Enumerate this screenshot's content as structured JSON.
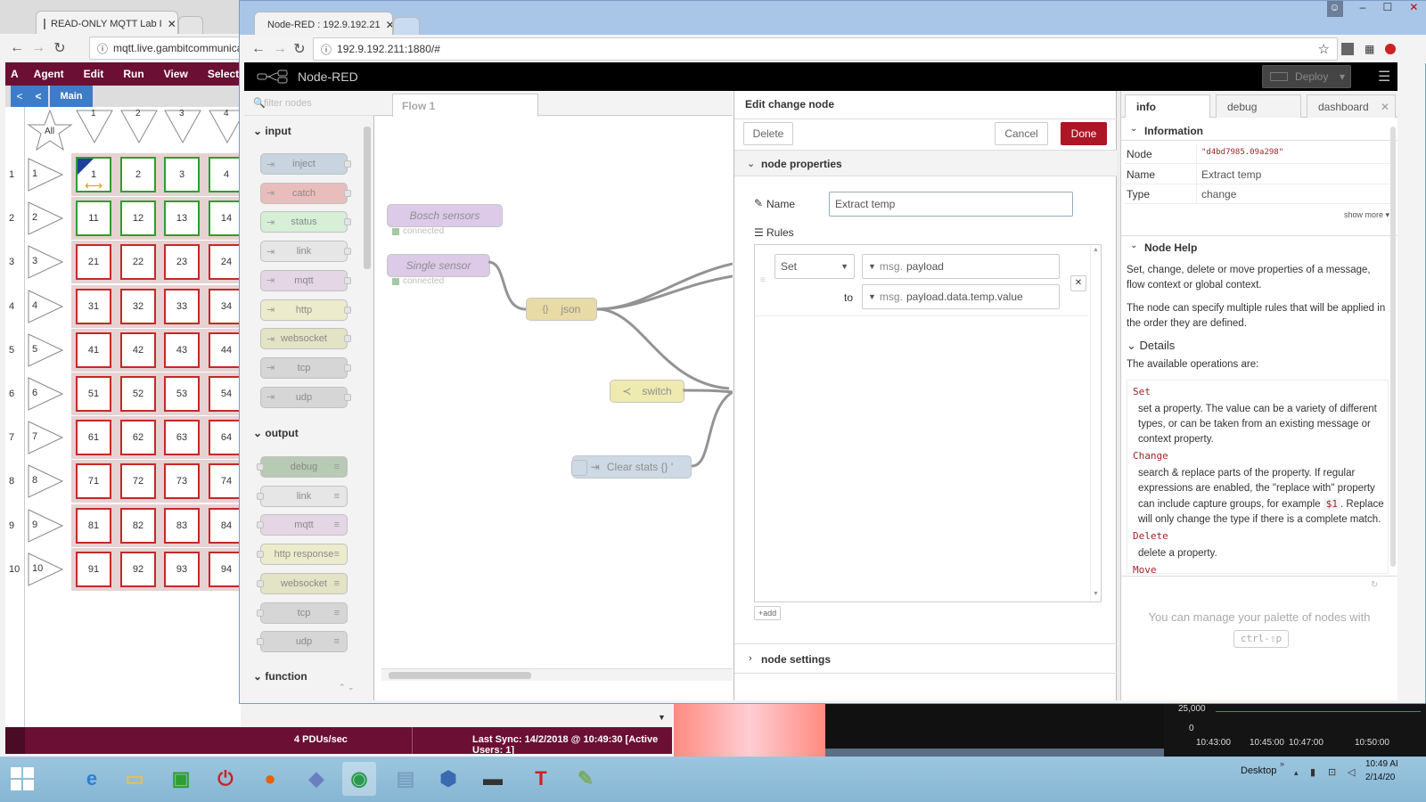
{
  "bg_browser": {
    "tab_title": "READ-ONLY MQTT Lab I",
    "url": "mqtt.live.gambitcommunica",
    "menu": [
      "Agent",
      "Edit",
      "Run",
      "View",
      "Select"
    ],
    "sub_back": "<",
    "sub_tab": "Main",
    "all_label": "All",
    "col_headers": [
      "1",
      "2",
      "3",
      "4"
    ],
    "rows": [
      {
        "label": "1",
        "cells": [
          "1",
          "2",
          "3",
          "4"
        ]
      },
      {
        "label": "2",
        "cells": [
          "11",
          "12",
          "13",
          "14"
        ]
      },
      {
        "label": "3",
        "cells": [
          "21",
          "22",
          "23",
          "24"
        ]
      },
      {
        "label": "4",
        "cells": [
          "31",
          "32",
          "33",
          "34"
        ]
      },
      {
        "label": "5",
        "cells": [
          "41",
          "42",
          "43",
          "44"
        ]
      },
      {
        "label": "6",
        "cells": [
          "51",
          "52",
          "53",
          "54"
        ]
      },
      {
        "label": "7",
        "cells": [
          "61",
          "62",
          "63",
          "64"
        ]
      },
      {
        "label": "8",
        "cells": [
          "71",
          "72",
          "73",
          "74"
        ]
      },
      {
        "label": "9",
        "cells": [
          "81",
          "82",
          "83",
          "84"
        ]
      },
      {
        "label": "10",
        "cells": [
          "91",
          "92",
          "93",
          "94"
        ]
      }
    ],
    "status_rate": "4 PDUs/sec",
    "status_sync": "Last Sync: 14/2/2018 @ 10:49:30 [Active Users: 1]"
  },
  "nr_browser": {
    "tab_title": "Node-RED : 192.9.192.21",
    "url": "192.9.192.211:1880/#"
  },
  "nodered": {
    "brand": "Node-RED",
    "deploy_label": "Deploy",
    "filter_placeholder": "filter nodes",
    "flow_tab": "Flow 1",
    "palette": {
      "input_title": "input",
      "input_nodes": [
        "inject",
        "catch",
        "status",
        "link",
        "mqtt",
        "http",
        "websocket",
        "tcp",
        "udp"
      ],
      "output_title": "output",
      "output_nodes": [
        "debug",
        "link",
        "mqtt",
        "http response",
        "websocket",
        "tcp",
        "udp"
      ],
      "function_title": "function"
    },
    "flow_nodes": {
      "bosch": "Bosch sensors",
      "bosch_status": "connected",
      "single": "Single sensor",
      "single_status": "connected",
      "json": "json",
      "switch": "switch",
      "clear": "Clear stats {} '"
    }
  },
  "editor": {
    "title": "Edit change node",
    "delete_label": "Delete",
    "cancel_label": "Cancel",
    "done_label": "Done",
    "props_section": "node properties",
    "name_label": "Name",
    "name_value": "Extract temp",
    "rules_label": "Rules",
    "rule_action": "Set",
    "msg_prefix": "msg.",
    "rule_property": "payload",
    "to_label": "to",
    "rule_value": "payload.data.temp.value",
    "add_label": "add",
    "settings_section": "node settings"
  },
  "sidebar": {
    "tabs": [
      "info",
      "debug",
      "dashboard"
    ],
    "info_section": "Information",
    "props": [
      {
        "key": "Node",
        "value": "\"d4bd7985.09a298\""
      },
      {
        "key": "Name",
        "value": "Extract temp"
      },
      {
        "key": "Type",
        "value": "change"
      }
    ],
    "show_more": "show more",
    "help_section": "Node Help",
    "help_p1": "Set, change, delete or move properties of a message, flow context or global context.",
    "help_p2": "The node can specify multiple rules that will be applied in the order they are defined.",
    "details_title": "Details",
    "details_intro": "The available operations are:",
    "op_set": "Set",
    "op_set_desc": "set a property. The value can be a variety of different types, or can be taken from an existing message or context property.",
    "op_change": "Change",
    "op_change_desc_a": "search & replace parts of the property. If regular expressions are enabled, the \"replace with\" property can include capture groups, for example",
    "op_change_code": "$1",
    "op_change_desc_b": ". Replace will only change the type if there is a complete match.",
    "op_delete": "Delete",
    "op_delete_desc": "delete a property.",
    "op_move": "Move",
    "tip_text": "You can manage your palette of nodes with",
    "tip_key": "ctrl-⇧p"
  },
  "bg_chart": {
    "y_ticks": [
      "25,000",
      "0"
    ],
    "x_ticks": [
      "10:43:00",
      "10:45:00",
      "10:47:00",
      "10:50:00"
    ]
  },
  "taskbar": {
    "desktop_label": "Desktop",
    "time": "10:49 AI",
    "date": "2/14/20"
  },
  "colors": {
    "mqtt_maroon": "#6b0f34",
    "nodered_red": "#ad1625",
    "cell_red": "#c62828",
    "cell_green": "#2e9e2e"
  }
}
